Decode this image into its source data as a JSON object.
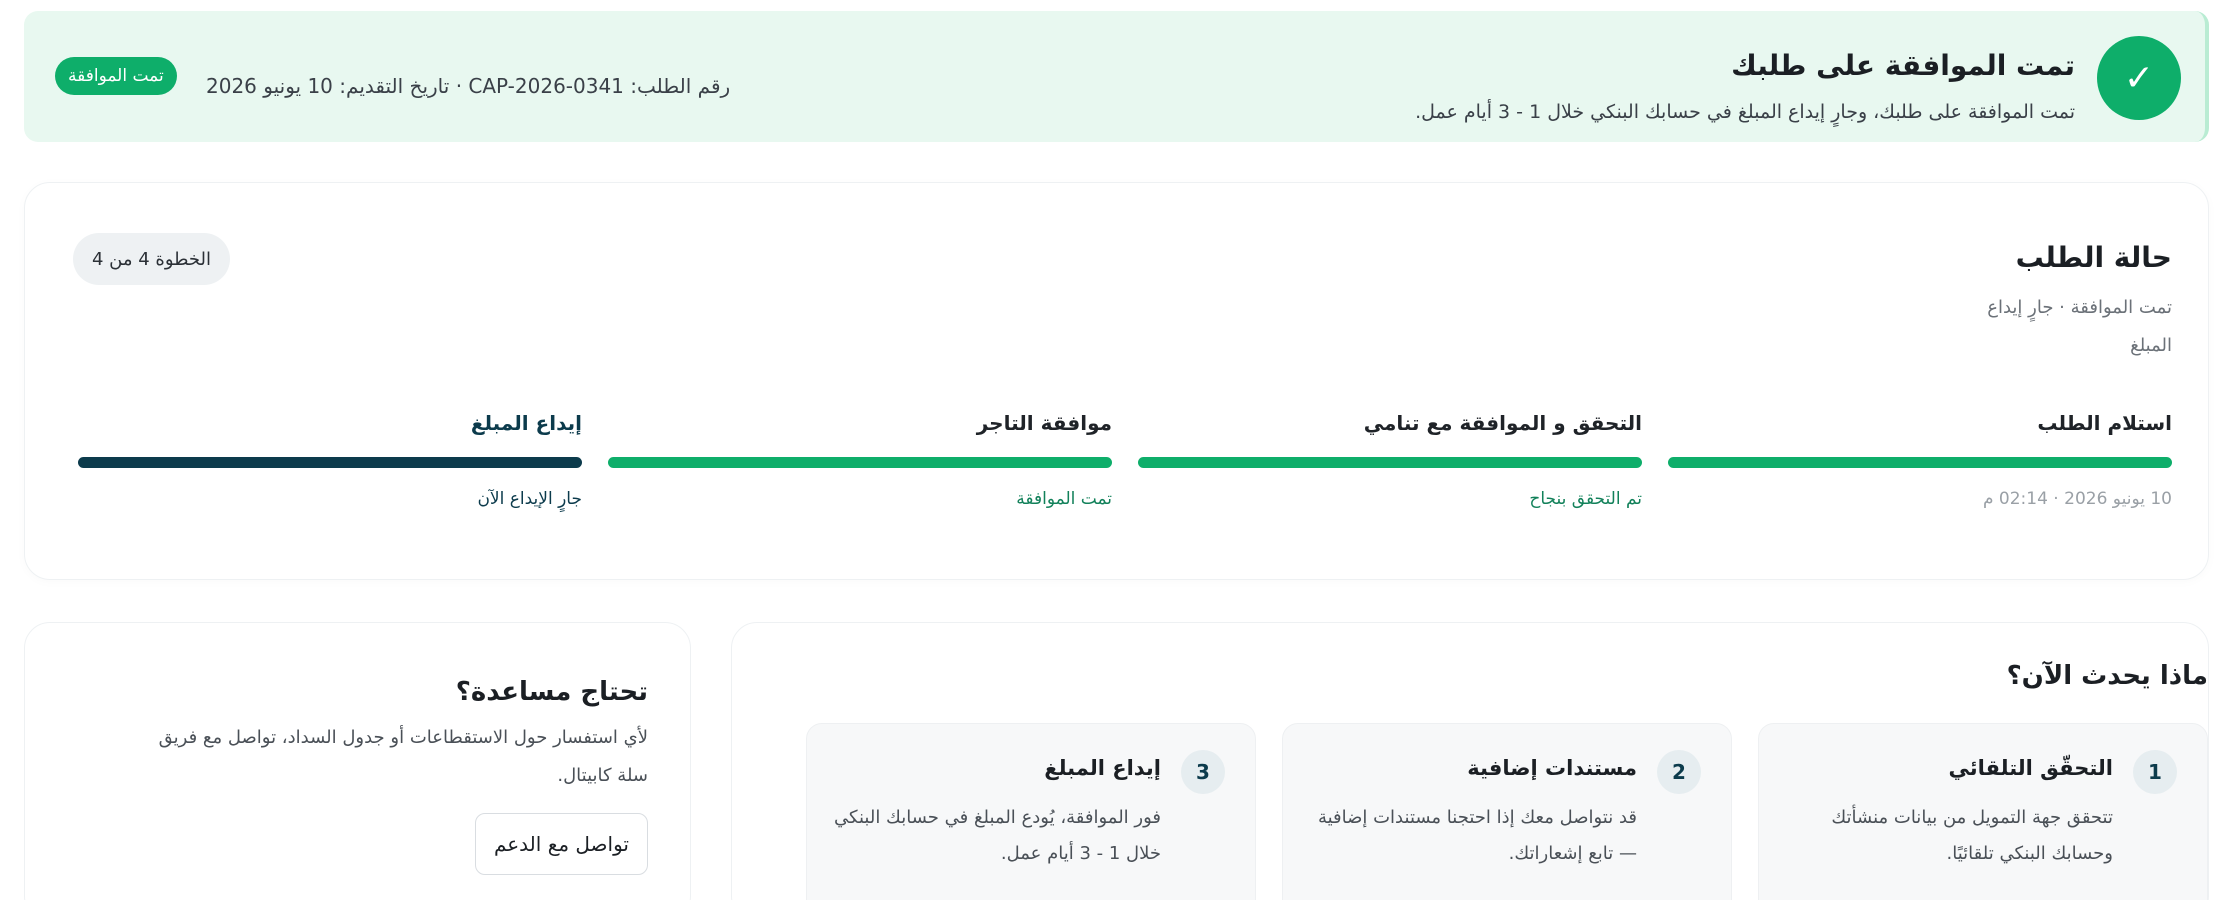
{
  "banner": {
    "title": "تمت الموافقة على طلبك",
    "subtitle": "تمت الموافقة على طلبك، وجارٍ إيداع المبلغ في حسابك البنكي خلال 1 - 3 أيام عمل.",
    "meta": "رقم الطلب: CAP-2026-0341 · تاريخ التقديم: 10 يونيو 2026",
    "badge": "تمت الموافقة",
    "check_glyph": "✓"
  },
  "status": {
    "title": "حالة الطلب",
    "subtitle": "تمت الموافقة · جارٍ إيداع المبلغ",
    "step_pill": "الخطوة 4 من 4",
    "steps": [
      {
        "label": "استلام الطلب",
        "note": "10 يونيو 2026 · 02:14 م"
      },
      {
        "label": "التحقق و الموافقة مع تنامي",
        "note": "تم التحقق بنجاح"
      },
      {
        "label": "موافقة التاجر",
        "note": "تمت الموافقة"
      },
      {
        "label": "إيداع المبلغ",
        "note": "جارٍ الإيداع الآن"
      }
    ]
  },
  "next": {
    "title": "ماذا يحدث الآن؟",
    "items": [
      {
        "num": "1",
        "title": "التحقّق التلقائي",
        "body": "تتحقق جهة التمويل من بيانات منشأتك وحسابك البنكي تلقائيًا."
      },
      {
        "num": "2",
        "title": "مستندات إضافية",
        "body": "قد نتواصل معك إذا احتجنا مستندات إضافية — تابع إشعاراتك."
      },
      {
        "num": "3",
        "title": "إيداع المبلغ",
        "body": "فور الموافقة، يُودع المبلغ في حسابك البنكي خلال 1 - 3 أيام عمل."
      }
    ]
  },
  "help": {
    "title": "تحتاج مساعدة؟",
    "body": "لأي استفسار حول الاستقطاعات أو جدول السداد، تواصل مع فريق سلة كابيتال.",
    "button": "تواصل مع الدعم"
  },
  "colors": {
    "brand_green": "#0eae6a",
    "dark_teal": "#0c3b4c",
    "banner_bg": "#e8f8f0"
  }
}
